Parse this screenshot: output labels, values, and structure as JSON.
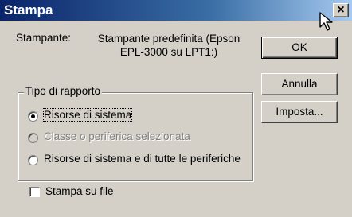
{
  "window": {
    "title": "Stampa",
    "close_label": "×"
  },
  "printer": {
    "label": "Stampante:",
    "value": "Stampante predefinita (Epson EPL-3000 su LPT1:)"
  },
  "buttons": {
    "ok": "OK",
    "cancel": "Annulla",
    "setup": "Imposta..."
  },
  "report_type": {
    "legend": "Tipo di rapporto",
    "options": [
      {
        "label": "Risorse di sistema",
        "selected": true,
        "enabled": true
      },
      {
        "label": "Classe o periferica selezionata",
        "selected": false,
        "enabled": false
      },
      {
        "label": "Risorse di sistema e di tutte le periferiche",
        "selected": false,
        "enabled": true
      }
    ]
  },
  "print_to_file": {
    "label": "Stampa su file",
    "checked": false
  }
}
